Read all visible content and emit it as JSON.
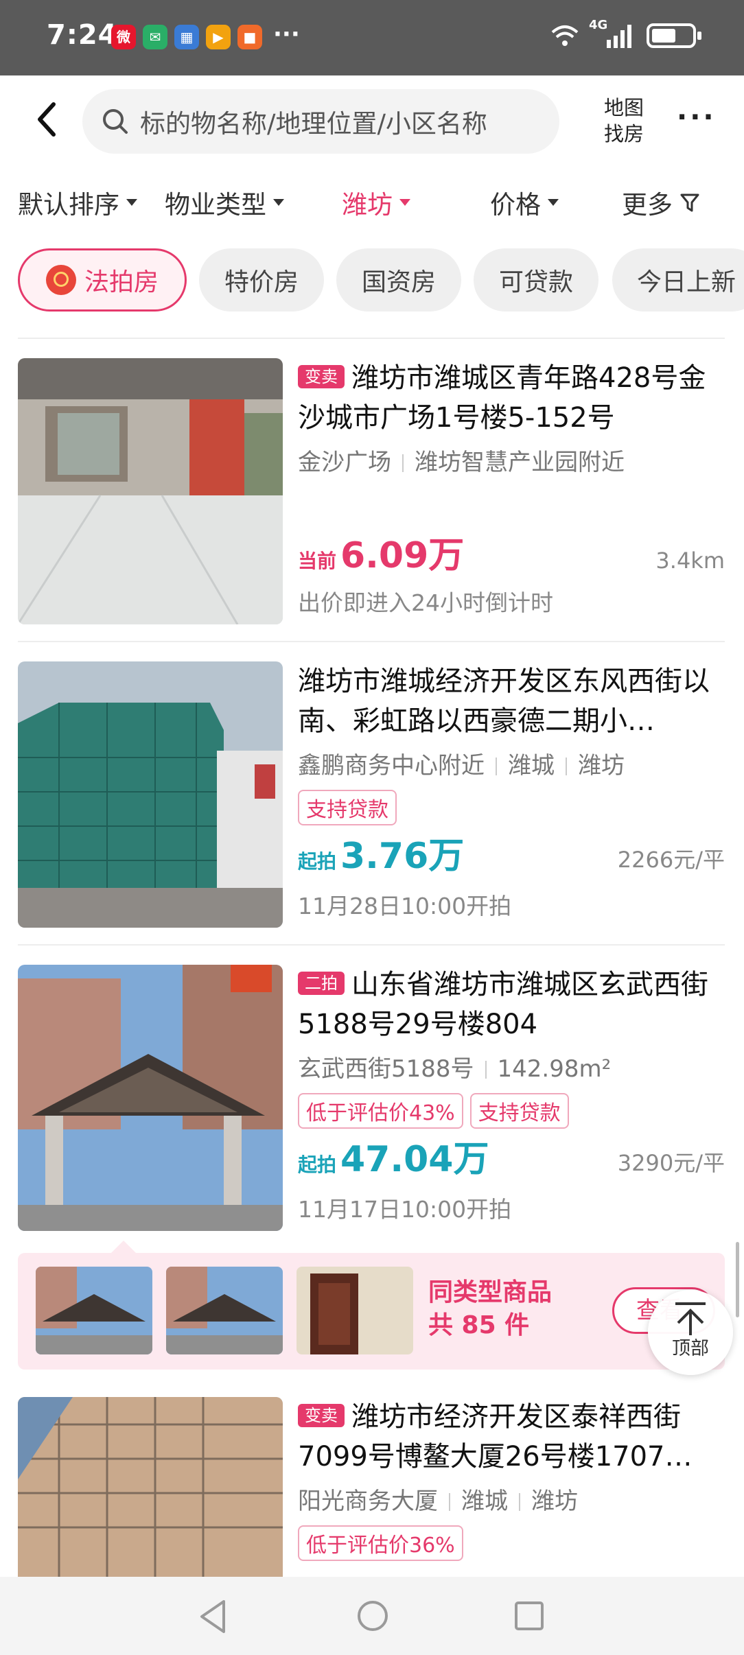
{
  "status_bar": {
    "time": "7:24",
    "network": "4G",
    "apps": [
      {
        "icon": "weibo-icon",
        "glyph": "微",
        "color": "#e6162d"
      },
      {
        "icon": "wechat-icon",
        "glyph": "✉",
        "color": "#2aae67"
      },
      {
        "icon": "calendar-icon",
        "glyph": "▦",
        "color": "#3a7bd5"
      },
      {
        "icon": "video-app-icon",
        "glyph": "▶",
        "color": "#f2a20f"
      },
      {
        "icon": "shop-app-icon",
        "glyph": "■",
        "color": "#f06a2a"
      }
    ],
    "more": "···"
  },
  "header": {
    "search_placeholder": "标的物名称/地理位置/小区名称",
    "map_line1": "地图",
    "map_line2": "找房",
    "more": "···"
  },
  "filters": [
    {
      "label": "默认排序",
      "active": false
    },
    {
      "label": "物业类型",
      "active": false
    },
    {
      "label": "潍坊",
      "active": true
    },
    {
      "label": "价格",
      "active": false
    },
    {
      "label": "更多",
      "active": false
    }
  ],
  "tags": [
    {
      "label": "法拍房",
      "active": true
    },
    {
      "label": "特价房",
      "active": false
    },
    {
      "label": "国资房",
      "active": false
    },
    {
      "label": "可贷款",
      "active": false
    },
    {
      "label": "今日上新",
      "active": false
    }
  ],
  "listings": [
    {
      "flag": "变卖",
      "title": "潍坊市潍城区青年路428号金沙城市广场1号楼5-152号",
      "meta": [
        "金沙广场",
        "潍坊智慧产业园附近"
      ],
      "pills": [],
      "price_label": "当前",
      "price": "6.09万",
      "price_color": "#e5396b",
      "right": "3.4km",
      "sub": "出价即进入24小时倒计时"
    },
    {
      "flag": "",
      "title": "潍坊市潍城经济开发区东风西街以南、彩虹路以西豪德二期小…",
      "meta": [
        "鑫鹏商务中心附近",
        "潍城",
        "潍坊"
      ],
      "pills": [
        "支持贷款"
      ],
      "price_label": "起拍",
      "price": "3.76万",
      "price_color": "#1aa3b8",
      "right": "2266元/平",
      "sub": "11月28日10:00开拍"
    },
    {
      "flag": "二拍",
      "title": "山东省潍坊市潍城区玄武西街5188号29号楼804",
      "meta": [
        "玄武西街5188号",
        "142.98m²"
      ],
      "pills": [
        "低于评估价43%",
        "支持贷款"
      ],
      "price_label": "起拍",
      "price": "47.04万",
      "price_color": "#1aa3b8",
      "right": "3290元/平",
      "sub": "11月17日10:00开拍"
    },
    {
      "flag": "变卖",
      "title": "潍坊市经济开发区泰祥西街7099号博鳌大厦26号楼1707…",
      "meta": [
        "阳光商务大厦",
        "潍城",
        "潍坊"
      ],
      "pills": [
        "低于评估价36%"
      ],
      "price_label": "",
      "price": "",
      "price_color": "#1aa3b8",
      "right": "",
      "sub": ""
    }
  ],
  "similar": {
    "line1": "同类型商品",
    "line2": "共 85 件",
    "button": "查看"
  },
  "top_button": "顶部"
}
